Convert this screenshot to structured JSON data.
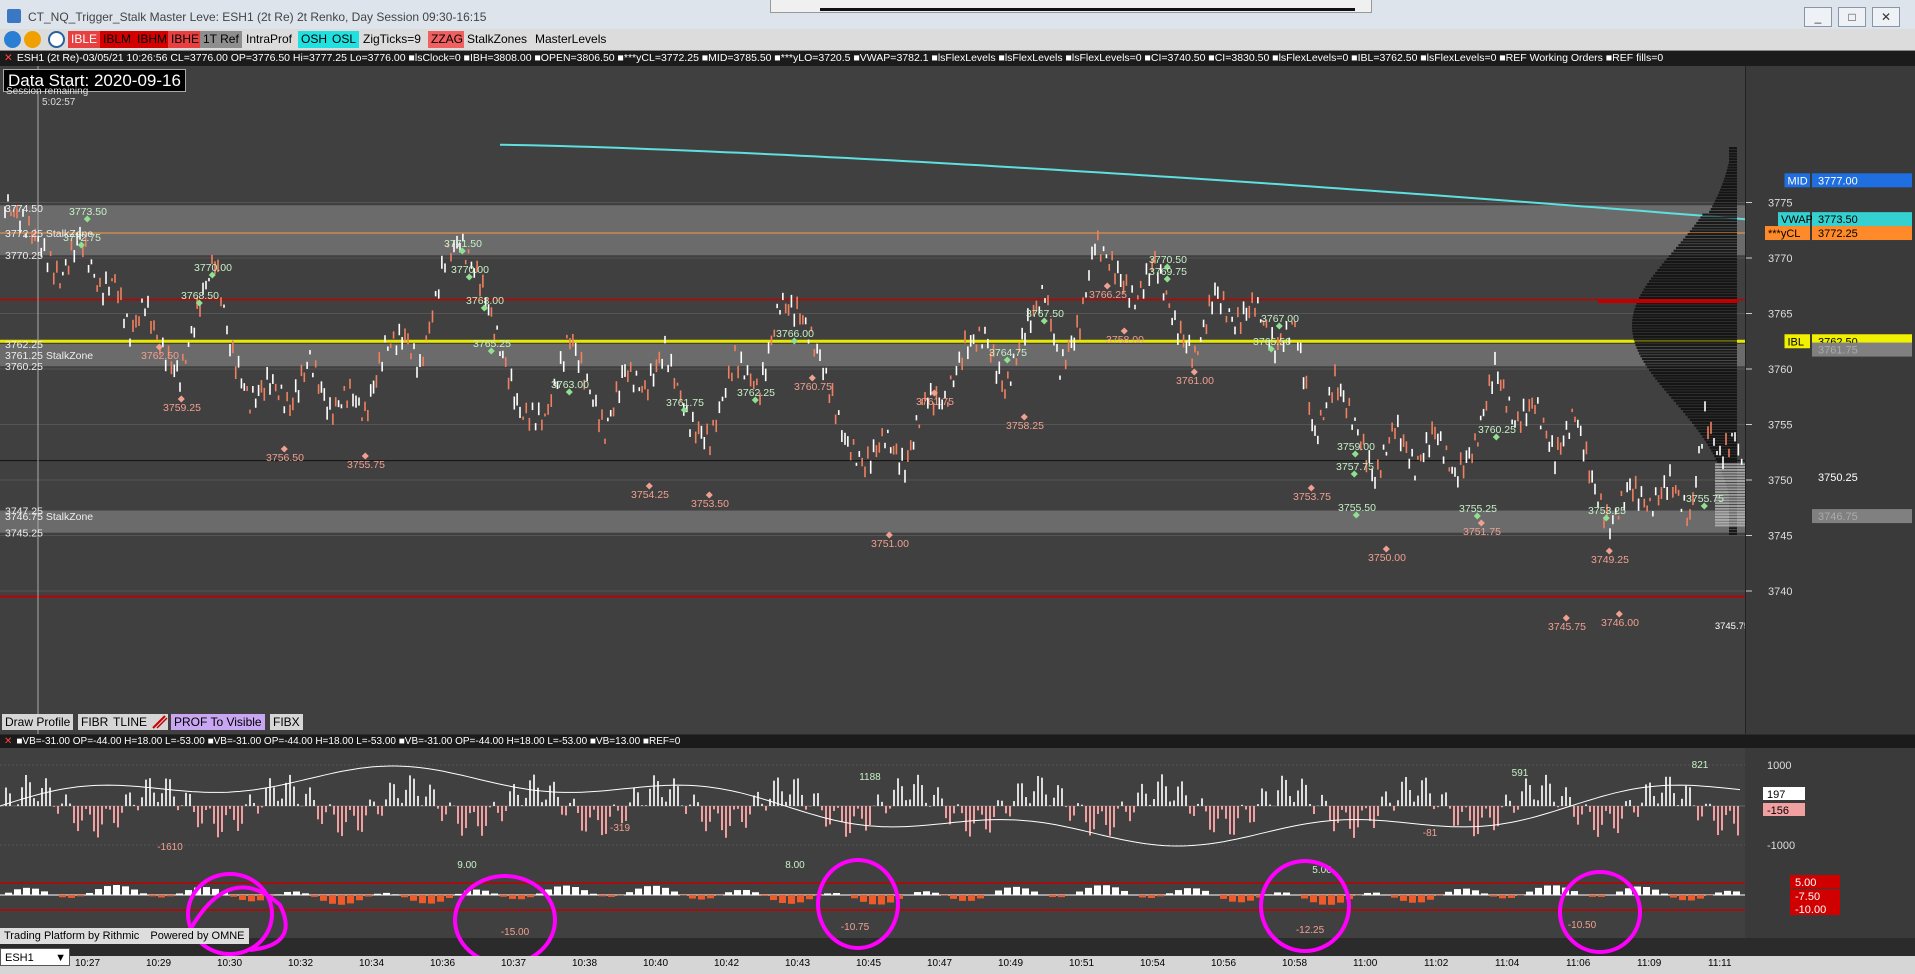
{
  "window": {
    "title": "CT_NQ_Trigger_Stalk Master Leve: ESH1 (2t Re) 2t Renko, Day Session 09:30-16:15",
    "buttons": [
      "_",
      "□",
      "✕"
    ]
  },
  "toolbar": {
    "buttons": [
      "IBLE",
      "IBLM",
      "IBHM",
      "IBHE",
      "1T Ref",
      "IntraProf",
      "OSH",
      "OSL",
      "ZigTicks=9",
      "ZZAG",
      "StalkZones",
      "MasterLevels"
    ]
  },
  "infobar": {
    "text": "ESH1 (2t Re)-03/05/21 10:26:56 CL=3776.00 OP=3776.50 Hi=3777.25 Lo=3776.00 ■lsClock=0 ■IBH=3808.00 ■OPEN=3806.50 ■***yCL=3772.25 ■MID=3785.50 ■***yLO=3720.5 ■VWAP=3782.1 ■lsFlexLevels ■lsFlexLevels ■lsFlexLevels=0 ■CI=3740.50 ■CI=3830.50 ■lsFlexLevels=0 ■IBL=3762.50 ■lsFlexLevels=0 ■REF Working Orders ■REF fills=0"
  },
  "chart": {
    "data_start": "Data Start:  2020-09-16",
    "session_remaining": "Session remaining",
    "session_time": "5:02:57",
    "price_ticks": [
      "3775",
      "3770",
      "3765",
      "3760",
      "3755",
      "3750",
      "3745",
      "3740"
    ],
    "right_labels": {
      "mid": "MID",
      "mid_value": "3777.00",
      "vwap": "VWAP",
      "vwap_value": "3773.50",
      "ycl": "***yCL",
      "ycl_value": "3772.25",
      "ibl": "IBL",
      "ibl_value": "3762.50",
      "stalk_top_value": "3761.75",
      "current_value": "3750.25",
      "stalk_bot_value": "3746.75"
    },
    "left_labels": [
      {
        "text": "3774.50"
      },
      {
        "text": "3772.25 StalkZone"
      },
      {
        "text": "3770.25"
      },
      {
        "text": "3762.25"
      },
      {
        "text": "3761.25 StalkZone"
      },
      {
        "text": "3760.25"
      },
      {
        "text": "3747.25"
      },
      {
        "text": "3746.75 StalkZone"
      },
      {
        "text": "3745.25"
      }
    ],
    "swing_highs": [
      "3773.50",
      "3772.75",
      "3770.00",
      "3768.50",
      "3771.50",
      "3770.00",
      "3768.00",
      "3766.00",
      "3765.25",
      "3763.00",
      "3762.25",
      "3761.75",
      "3767.50",
      "3764.75",
      "3770.50",
      "3769.75",
      "3767.00",
      "3765.50",
      "3759.00",
      "3757.75",
      "3755.50",
      "3755.75",
      "3753.25",
      "3760.25",
      "3755.25"
    ],
    "swing_lows": [
      "3762.50",
      "3759.25",
      "3756.50",
      "3755.75",
      "3753.50",
      "3751.00",
      "3754.25",
      "3760.75",
      "3758.00",
      "3761.75",
      "3761.00",
      "3753.75",
      "3750.00",
      "3749.25",
      "3745.75",
      "3746.00",
      "3751.75",
      "3758.25",
      "3766.25"
    ],
    "last_low_label": "3745.75"
  },
  "draw_toolbar": {
    "buttons": [
      "Draw Profile",
      "FIBR",
      "TLINE",
      "PROF To Visible",
      "FIBX"
    ]
  },
  "indicator_bar": {
    "text": "■VB=-31.00 OP=-44.00 H=18.00 L=-53.00 ■VB=-31.00 OP=-44.00 H=18.00 L=-53.00 ■VB=-31.00 OP=-44.00 H=18.00 L=-53.00 ■VB=13.00 ■REF=0"
  },
  "indicator1": {
    "ticks": [
      "1000",
      "197",
      "-156",
      "-1000"
    ],
    "labels": [
      "1188",
      "-1610",
      "591",
      "821",
      "-319",
      "-81"
    ]
  },
  "indicator2": {
    "labels": [
      "-10.75",
      "-10.50",
      "-12.25",
      "-15.00",
      "9.00",
      "8.00",
      "5.00"
    ],
    "right_values": [
      "5.00",
      "-7.50",
      "-10.00"
    ]
  },
  "bottom": {
    "platform": "Trading Platform by Rithmic",
    "powered": "Powered by OMNE",
    "symbol": "ESH1"
  },
  "time_axis": [
    "10:27",
    "10:29",
    "10:30",
    "10:32",
    "10:34",
    "10:36",
    "10:37",
    "10:38",
    "10:40",
    "10:42",
    "10:43",
    "10:45",
    "10:47",
    "10:49",
    "10:51",
    "10:54",
    "10:56",
    "10:58",
    "11:00",
    "11:02",
    "11:04",
    "11:06",
    "11:09",
    "11:11"
  ],
  "annotations": {
    "circle_count": 6,
    "circle_color": "#ff00ff"
  },
  "colors": {
    "stalk_zone": "#7a7a7a",
    "ibl_line": "#e8e800",
    "vwap_line": "#5ee0e0",
    "ycl_line": "#ff9a3c",
    "red_line": "#c00000",
    "candle_up": "#ffffff",
    "candle_down": "#f08060",
    "swing_high_text": "#c8f0c8",
    "swing_low_text": "#f0a090"
  }
}
